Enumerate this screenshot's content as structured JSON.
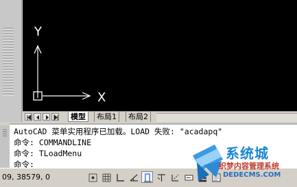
{
  "viewport": {
    "axis_y_label": "Y",
    "axis_x_label": "X",
    "background": "#000000"
  },
  "tabs": [
    {
      "label": "模型",
      "active": true
    },
    {
      "label": "布局1",
      "active": false
    },
    {
      "label": "布局2",
      "active": false
    }
  ],
  "nav_icons": [
    "first-tab-icon",
    "prev-tab-icon",
    "next-tab-icon",
    "last-tab-icon"
  ],
  "command": {
    "lines": [
      "AutoCAD 菜单实用程序已加载。LOAD 失败: \"acadapq\"",
      "命令: COMMANDLINE",
      "命令: TLoadMenu",
      "命令:"
    ]
  },
  "status": {
    "coordinates": "09, 38579, 0",
    "buttons": [
      {
        "icon": "snap-mode-icon",
        "on": false
      },
      {
        "icon": "grid-display-icon",
        "on": false
      },
      {
        "icon": "ortho-mode-icon",
        "on": false
      },
      {
        "icon": "polar-tracking-icon",
        "on": false
      },
      {
        "icon": "object-snap-icon",
        "on": true
      },
      {
        "icon": "object-snap-tracking-icon",
        "on": false
      },
      {
        "icon": "allow-ucs-icon",
        "on": false
      },
      {
        "icon": "dynamic-input-icon",
        "on": false
      },
      {
        "icon": "lineweight-icon",
        "on": false
      },
      {
        "icon": "quick-properties-icon",
        "on": false
      }
    ]
  },
  "watermark": {
    "brand": "系统城",
    "subtitle": "织梦内容管理系统",
    "url": "DEDECMS.COM"
  },
  "colors": {
    "accent": "#1a86d6",
    "ucs_icon": "#ffffff"
  }
}
